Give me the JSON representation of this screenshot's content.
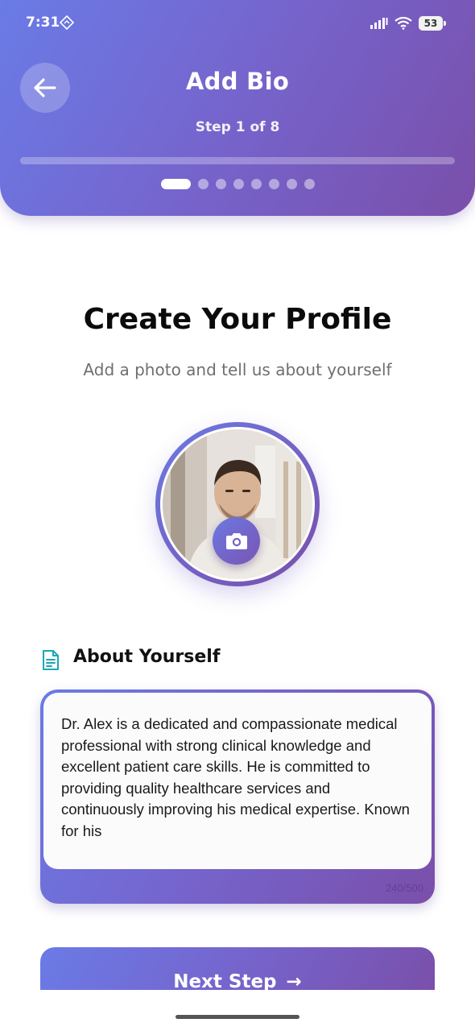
{
  "status_bar": {
    "time": "7:31",
    "battery": "53"
  },
  "header": {
    "title": "Add Bio",
    "step_text": "Step 1 of 8",
    "current_step": 1,
    "total_steps": 8,
    "progress": 0.0
  },
  "main": {
    "title": "Create Your Profile",
    "subtitle": "Add a photo and tell us about yourself"
  },
  "about": {
    "heading": "About Yourself",
    "bio_text": "Dr. Alex is a dedicated and compassionate medical professional with strong clinical knowledge and excellent patient care skills. He is committed to providing quality healthcare services and continuously improving his medical expertise. Known for his",
    "char_counter": "240/500"
  },
  "next_button": {
    "label": "Next Step",
    "arrow": "→"
  },
  "colors": {
    "gradient_start": "#6a7be6",
    "gradient_end": "#7a4faa",
    "icon_teal": "#1ba7b5"
  }
}
